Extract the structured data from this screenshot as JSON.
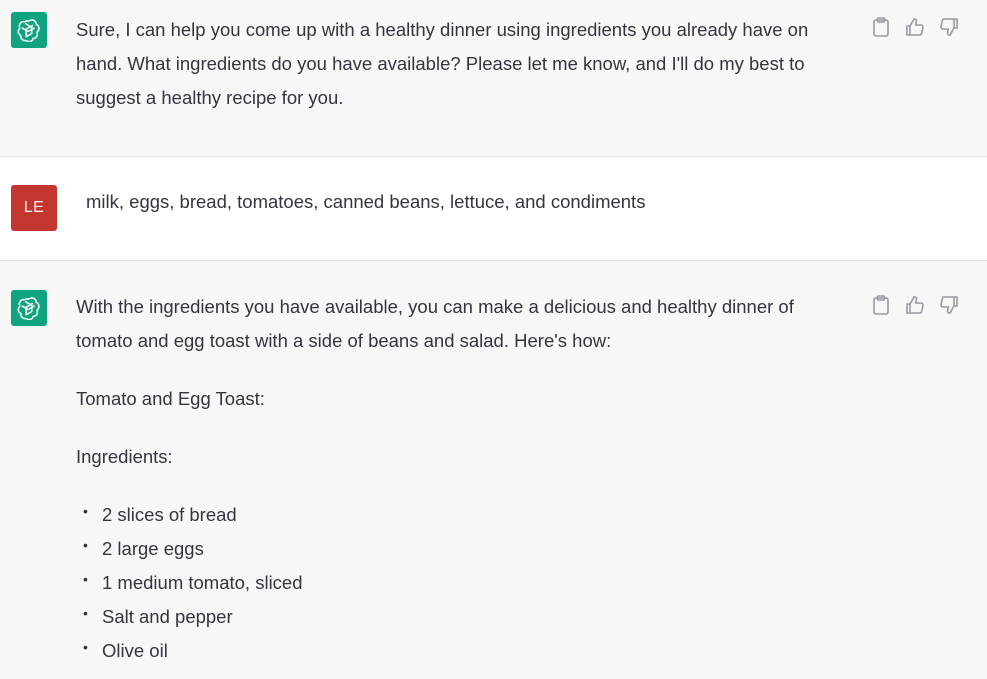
{
  "messages": [
    {
      "role": "assistant",
      "text": "Sure, I can help you come up with a healthy dinner using ingredients you already have on hand. What ingredients do you have available? Please let me know, and I'll do my best to suggest a healthy recipe for you."
    },
    {
      "role": "user",
      "avatar_initials": "LE",
      "text": "milk, eggs, bread, tomatoes, canned beans, lettuce, and condiments"
    },
    {
      "role": "assistant",
      "intro": "With the ingredients you have available, you can make a delicious and healthy dinner of tomato and egg toast with a side of beans and salad. Here's how:",
      "recipe_title": "Tomato and Egg Toast:",
      "ingredients_heading": "Ingredients:",
      "ingredients": [
        "2 slices of bread",
        "2 large eggs",
        "1 medium tomato, sliced",
        "Salt and pepper",
        "Olive oil"
      ]
    }
  ],
  "bullet_char": "•",
  "icons": {
    "copy": "clipboard-icon",
    "like": "thumbs-up-icon",
    "dislike": "thumbs-down-icon",
    "assistant_avatar": "openai-logo-icon"
  },
  "colors": {
    "assistant_avatar_bg": "#10a37f",
    "user_avatar_bg": "#c2362e",
    "assistant_bg": "#f7f7f8",
    "user_bg": "#ffffff"
  }
}
